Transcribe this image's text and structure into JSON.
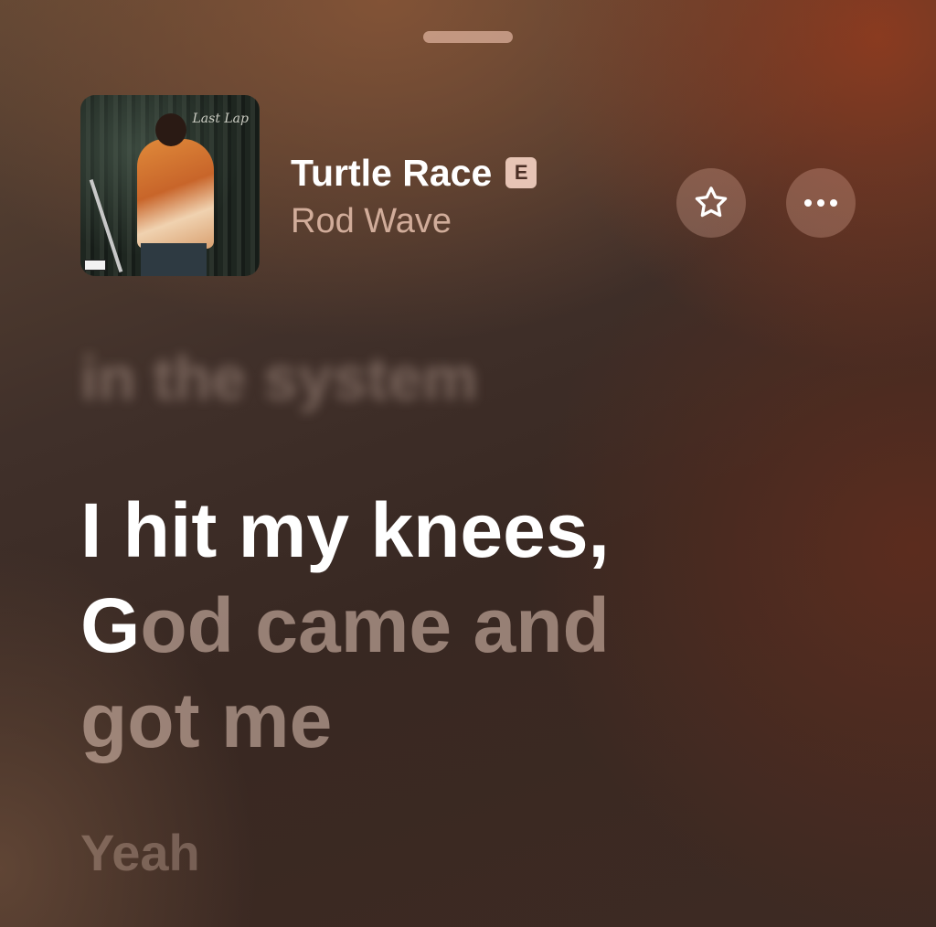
{
  "now_playing": {
    "title": "Turtle Race",
    "explicit_badge": "E",
    "artist": "Rod Wave"
  },
  "artwork": {
    "script_text": "Last Lap"
  },
  "actions": {
    "favorite_icon": "star-icon",
    "more_icon": "ellipsis-icon"
  },
  "lyrics": {
    "previous_line": "in the system",
    "current_line_1_sung": "I hit my knees,",
    "current_line_2_sung": "G",
    "current_line_2_unsung": "od came and",
    "current_line_3_unsung": "got me",
    "next_line": "Yeah"
  },
  "colors": {
    "accent_warm": "#8a3a20",
    "text_primary": "#ffffff",
    "badge_bg": "#ffdccd"
  }
}
